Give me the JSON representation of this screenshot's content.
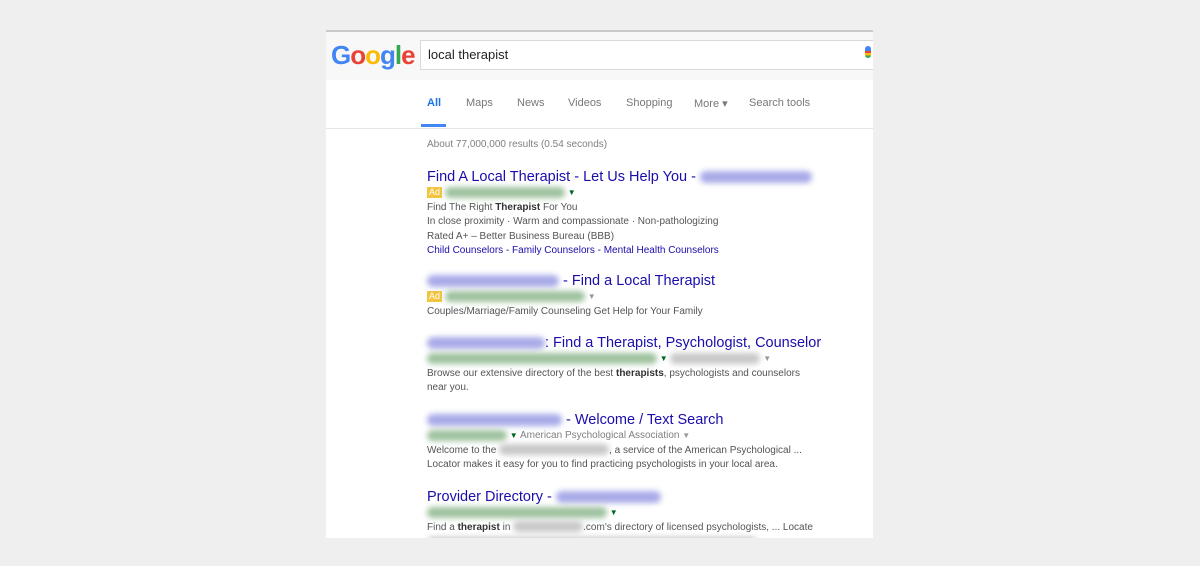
{
  "search": {
    "query": "local therapist"
  },
  "tabs": [
    {
      "label": "All"
    },
    {
      "label": "Maps"
    },
    {
      "label": "News"
    },
    {
      "label": "Videos"
    },
    {
      "label": "Shopping"
    },
    {
      "label": "More ▾"
    },
    {
      "label": "Search tools"
    }
  ],
  "stats": "About 77,000,000 results (0.54 seconds)",
  "ad_badge": "Ad",
  "results": [
    {
      "title": "Find A Local Therapist - Let Us Help You -",
      "line1_pre": "Find The Right ",
      "line1_bold": "Therapist",
      "line1_post": " For You",
      "line2": "In close proximity · Warm and compassionate · Non-pathologizing",
      "line3": "Rated A+ – Better Business Bureau (BBB)",
      "links": "Child Counselors - Family Counselors - Mental Health Counselors"
    },
    {
      "title": "- Find a Local Therapist",
      "desc": "Couples/Marriage/Family Counseling Get Help for Your Family"
    },
    {
      "title": ": Find a Therapist, Psychologist, Counselor",
      "desc1_pre": "Browse our extensive directory of the best ",
      "desc1_bold": "therapists",
      "desc1_post": ", psychologists and counselors",
      "desc2": "near you."
    },
    {
      "title": "- Welcome / Text Search",
      "url_text": "American Psychological Association",
      "desc1_pre": "Welcome to the",
      "desc1_post": ", a service of the American Psychological ...",
      "desc2": "Locator makes it easy for you to find practicing psychologists in your local area."
    },
    {
      "title": "Provider Directory -",
      "desc1_pre": "Find a ",
      "desc1_bold": "therapist",
      "desc1_mid": " in",
      "desc1_post": ".com's directory of licensed psychologists, ... Locate"
    }
  ]
}
